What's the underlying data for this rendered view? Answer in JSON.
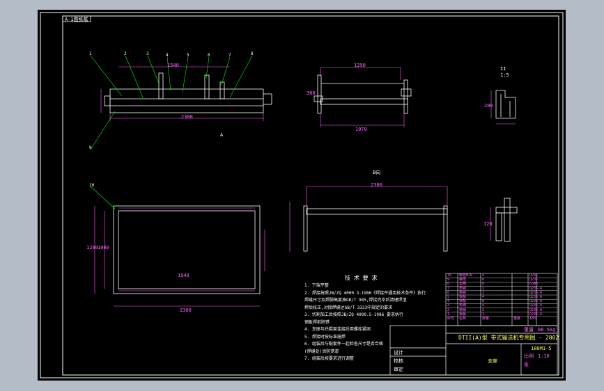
{
  "drawing_tag": "A-1图纸框",
  "title_block": {
    "title_line": "DTII(A)型  带式输送机专用图 - 2002",
    "drawing_number": "180M1-5",
    "field_weight_label": "重量",
    "field_weight_value": "88.5kg",
    "field_scale_label": "比例",
    "field_scale_value": "1:10",
    "field_sheet_label": "张",
    "footer_name": "支座",
    "design_label": "设计",
    "check_label": "校核",
    "approve_label": "审定"
  },
  "tech_requirements": {
    "heading": "技 术 要 求",
    "lines": [
      "1. 下端平整",
      "2. 焊接按照JB/ZQ 4000.3-1986《焊接件通用技术条件》执行",
      "   焊缝尺寸及焊脚高度按GB/T 985,焊接完毕后清理焊渣",
      "   焊后校正,对接焊缝达GB/T 3323中规定的要求",
      "3. 切割加工后按照JB/ZQ 4000.5-1986 要求执行",
      "   钢板焊前除锈",
      "4. 支座与托辊架连接后用螺栓紧固",
      "5. 焊接时按标准施焊",
      "6. 组装后与配套件一起检查尺寸是否合格",
      "   (焊缝处)涂防锈漆",
      "7. 组装后按要求进行调整"
    ]
  },
  "view_labels": {
    "section_a": "A",
    "view_b": "B向",
    "detail_scale": "1:5",
    "detail_label": "II"
  },
  "dims": {
    "top_overall": "2300",
    "top_mid": "1540",
    "side_width": "1290",
    "side_height": "300",
    "side_bottom": "1070",
    "plan_len": "2300",
    "plan_inner": "1940",
    "plan_height": "1280",
    "plan_inner_h": "1000",
    "elev_len": "2300",
    "detail_w": "200",
    "detail_h": "120"
  },
  "leaders": [
    "1",
    "2",
    "3",
    "4",
    "5",
    "6",
    "7",
    "8",
    "9",
    "10"
  ],
  "parts_table": {
    "rows": [
      [
        "10",
        "螺栓M20",
        "4",
        "",
        "Q235"
      ],
      [
        "9",
        "螺母",
        "8",
        "",
        "Q235"
      ],
      [
        "8",
        "垫圈",
        "8",
        "",
        "65Mn"
      ],
      [
        "7",
        "角钢",
        "2",
        "",
        "Q235-A"
      ],
      [
        "6",
        "槽钢",
        "2",
        "",
        "Q235-A"
      ],
      [
        "5",
        "钢板",
        "4",
        "",
        "Q235-A"
      ],
      [
        "4",
        "钢板",
        "8",
        "",
        "Q235-A"
      ],
      [
        "3",
        "角钢",
        "4",
        "",
        "Q235-A"
      ],
      [
        "2",
        "槽钢",
        "2",
        "",
        "Q235-A"
      ],
      [
        "1",
        "钢板",
        "2",
        "",
        "Q235-A"
      ]
    ],
    "header": [
      "序号",
      "名称",
      "数量",
      "重量",
      "材料"
    ]
  },
  "colors": {
    "sheet": "#000000",
    "line": "#ffffff",
    "dim": "#ff66ff",
    "leader": "#00ff00",
    "text_y": "#ffff55",
    "center": "#ff3333"
  }
}
